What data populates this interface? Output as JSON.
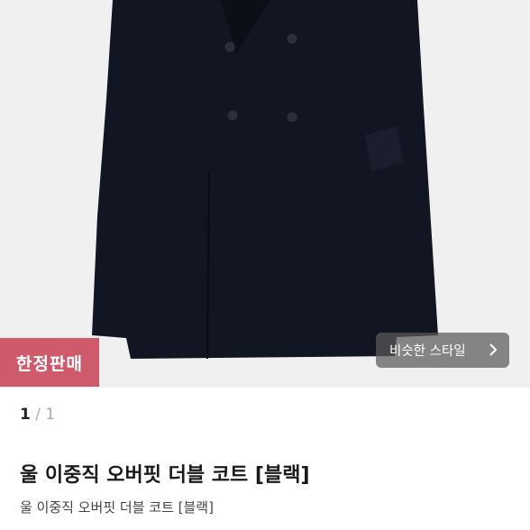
{
  "colors": {
    "hero_bg": "#f0f0f0",
    "coat": "#121522",
    "badge": "#cf5a6c"
  },
  "hero": {
    "badge_label": "한정판매",
    "similar_style_label": "비슷한 스타일"
  },
  "pager": {
    "current": "1",
    "separator": "/",
    "total": "1"
  },
  "product": {
    "title": "울 이중직 오버핏 더블 코트 [블랙]",
    "subtitle": "울 이중직 오버핏 더블 코트 [블랙]"
  },
  "icons": [
    "chevron-right-icon"
  ]
}
